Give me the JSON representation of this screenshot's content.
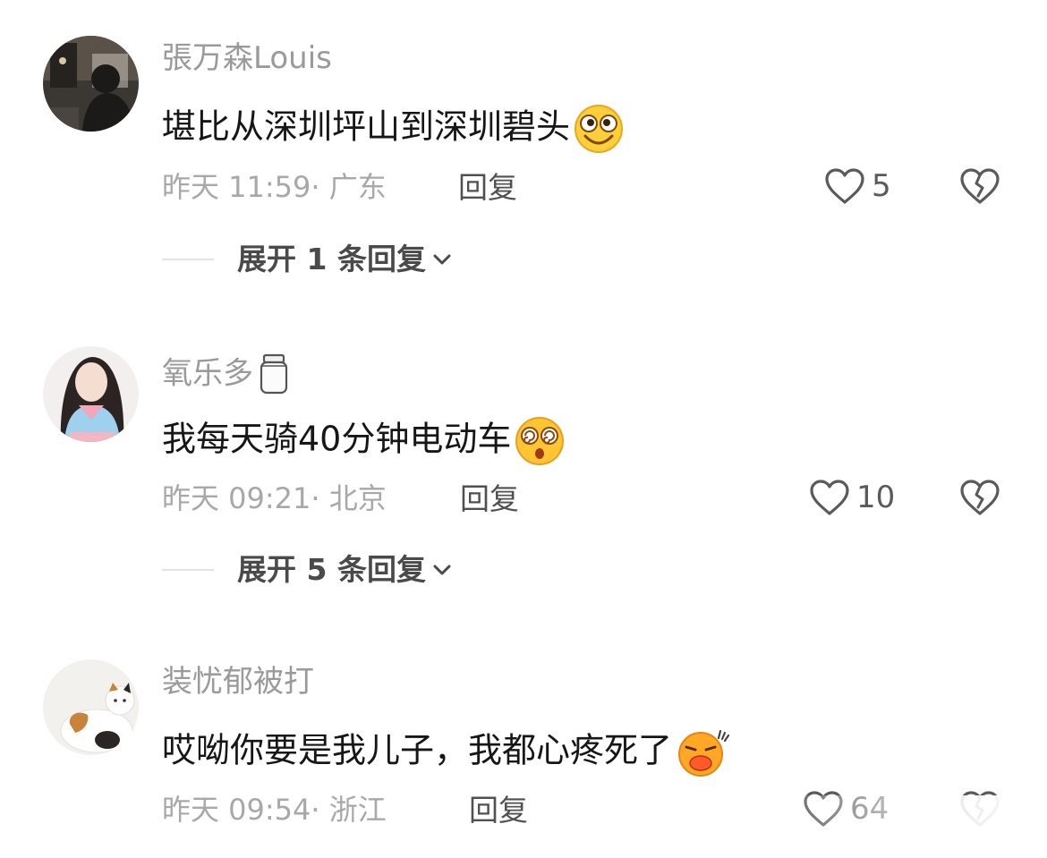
{
  "comments": [
    {
      "username": "張万森Louis",
      "text": "堪比从深圳坪山到深圳碧头",
      "emoji_icon": "grinning-emoji",
      "time": "昨天 11:59",
      "location": "广东",
      "reply_label": "回复",
      "likes": "5",
      "expand_label": "展开 1 条回复"
    },
    {
      "username": "氧乐多",
      "username_icon": "jar-icon",
      "text": "我每天骑40分钟电动车",
      "emoji_icon": "dizzy-emoji",
      "time": "昨天 09:21",
      "location": "北京",
      "reply_label": "回复",
      "likes": "10",
      "expand_label": "展开 5 条回复"
    },
    {
      "username": "装忧郁被打",
      "text": "哎呦你要是我儿子，我都心疼死了",
      "emoji_icon": "pouting-emoji",
      "time": "昨天 09:54",
      "location": "浙江",
      "reply_label": "回复",
      "likes": "64"
    }
  ],
  "colors": {
    "username": "#9a9a9a",
    "comment_text": "#161616",
    "meta": "#a8a8a8",
    "reply": "#505050",
    "icon_stroke": "#5a5a5a"
  }
}
